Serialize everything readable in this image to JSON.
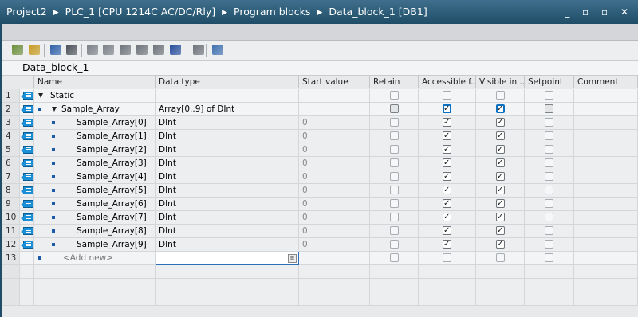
{
  "breadcrumb": [
    "Project2",
    "PLC_1 [CPU 1214C AC/DC/Rly]",
    "Program blocks",
    "Data_block_1 [DB1]"
  ],
  "window_controls": "_ ▫ ▫ ✕",
  "block_title": "Data_block_1",
  "toolbar_icons": [
    "insert-row-icon",
    "add-row-icon",
    "snapshot-icon",
    "copy-snapshot-icon",
    "reset-start-values-icon",
    "load-start-values-icon",
    "monitor-values-icon",
    "copy-values-icon",
    "expand-all-icon",
    "collapse-all-icon",
    "keep-actual-values-icon",
    "monitor-all-icon"
  ],
  "columns": [
    "Name",
    "Data type",
    "Start value",
    "Retain",
    "Accessible f...",
    "Visible in ...",
    "Setpoint",
    "Comment"
  ],
  "rows": [
    {
      "num": "1",
      "name": "Static",
      "type": "",
      "start": "",
      "retain": false,
      "access": false,
      "visible": false,
      "setpoint": false,
      "level": 0,
      "kind": "section"
    },
    {
      "num": "2",
      "name": "Sample_Array",
      "type": "Array[0..9] of DInt",
      "start": "",
      "retain": false,
      "access": true,
      "visible": true,
      "setpoint": false,
      "level": 1,
      "kind": "array"
    },
    {
      "num": "3",
      "name": "Sample_Array[0]",
      "type": "DInt",
      "start": "0",
      "retain": false,
      "access": true,
      "visible": true,
      "setpoint": false,
      "level": 2,
      "kind": "element"
    },
    {
      "num": "4",
      "name": "Sample_Array[1]",
      "type": "DInt",
      "start": "0",
      "retain": false,
      "access": true,
      "visible": true,
      "setpoint": false,
      "level": 2,
      "kind": "element"
    },
    {
      "num": "5",
      "name": "Sample_Array[2]",
      "type": "DInt",
      "start": "0",
      "retain": false,
      "access": true,
      "visible": true,
      "setpoint": false,
      "level": 2,
      "kind": "element"
    },
    {
      "num": "6",
      "name": "Sample_Array[3]",
      "type": "DInt",
      "start": "0",
      "retain": false,
      "access": true,
      "visible": true,
      "setpoint": false,
      "level": 2,
      "kind": "element"
    },
    {
      "num": "7",
      "name": "Sample_Array[4]",
      "type": "DInt",
      "start": "0",
      "retain": false,
      "access": true,
      "visible": true,
      "setpoint": false,
      "level": 2,
      "kind": "element"
    },
    {
      "num": "8",
      "name": "Sample_Array[5]",
      "type": "DInt",
      "start": "0",
      "retain": false,
      "access": true,
      "visible": true,
      "setpoint": false,
      "level": 2,
      "kind": "element"
    },
    {
      "num": "9",
      "name": "Sample_Array[6]",
      "type": "DInt",
      "start": "0",
      "retain": false,
      "access": true,
      "visible": true,
      "setpoint": false,
      "level": 2,
      "kind": "element"
    },
    {
      "num": "10",
      "name": "Sample_Array[7]",
      "type": "DInt",
      "start": "0",
      "retain": false,
      "access": true,
      "visible": true,
      "setpoint": false,
      "level": 2,
      "kind": "element"
    },
    {
      "num": "11",
      "name": "Sample_Array[8]",
      "type": "DInt",
      "start": "0",
      "retain": false,
      "access": true,
      "visible": true,
      "setpoint": false,
      "level": 2,
      "kind": "element"
    },
    {
      "num": "12",
      "name": "Sample_Array[9]",
      "type": "DInt",
      "start": "0",
      "retain": false,
      "access": true,
      "visible": true,
      "setpoint": false,
      "level": 2,
      "kind": "element"
    },
    {
      "num": "13",
      "name": "<Add new>",
      "type": "",
      "start": "",
      "retain": false,
      "access": false,
      "visible": false,
      "setpoint": false,
      "level": 0,
      "kind": "add"
    }
  ]
}
